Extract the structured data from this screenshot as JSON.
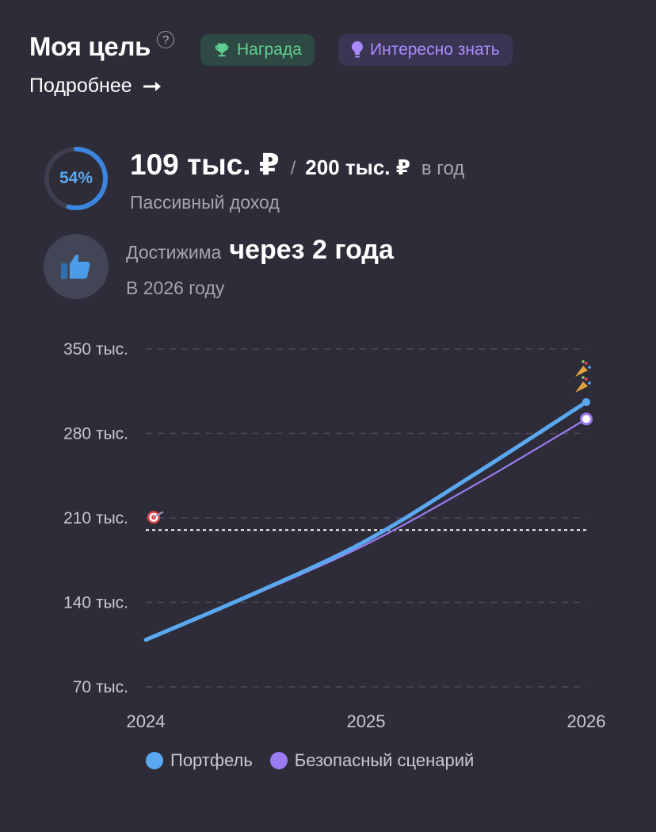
{
  "header": {
    "title": "Моя цель",
    "help_symbol": "?",
    "award_chip": "Награда",
    "info_chip": "Интересно знать",
    "more_link": "Подробнее",
    "icons": {
      "help": "question-circle-icon",
      "award": "trophy-icon",
      "info": "lightbulb-icon",
      "arrow": "arrow-right-icon"
    }
  },
  "goal": {
    "progress_pct": 54,
    "progress_label": "54%",
    "current_amount": "109 тыс. ₽",
    "separator": "/",
    "target_amount": "200 тыс. ₽",
    "period": "в год",
    "subtitle": "Пассивный доход"
  },
  "reach": {
    "label": "Достижима",
    "value": "через 2 года",
    "subtitle": "В 2026 году",
    "icon": "thumbs-up-icon"
  },
  "colors": {
    "background": "#2d2c38",
    "portfolio": "#5aa8f0",
    "safe": "#9b7cf0",
    "progress": "#3a86df",
    "award_text": "#5fd08f",
    "info_text": "#a98bff"
  },
  "chart_data": {
    "type": "line",
    "x": [
      2024,
      2025,
      2026
    ],
    "x_tick_labels": [
      "2024",
      "2025",
      "2026"
    ],
    "y_ticks": [
      70000,
      140000,
      210000,
      280000,
      350000
    ],
    "y_tick_labels": [
      "70 тыс.",
      "140 тыс.",
      "210 тыс.",
      "280 тыс.",
      "350 тыс."
    ],
    "ylim": [
      70000,
      350000
    ],
    "goal_value": 200000,
    "goal_icon": "target-icon",
    "end_icon": "party-popper-icon",
    "series": [
      {
        "name": "Портфель",
        "x": [
          2024,
          2024.5,
          2025,
          2025.5,
          2026
        ],
        "values": [
          109000,
          148000,
          191000,
          247000,
          306000
        ],
        "color": "#5aa8f0"
      },
      {
        "name": "Безопасный сценарий",
        "x": [
          2024,
          2024.5,
          2025,
          2025.5,
          2026
        ],
        "values": [
          109000,
          147000,
          188000,
          238000,
          292000
        ],
        "color": "#9b7cf0"
      }
    ],
    "grid": true,
    "legend_position": "bottom"
  }
}
